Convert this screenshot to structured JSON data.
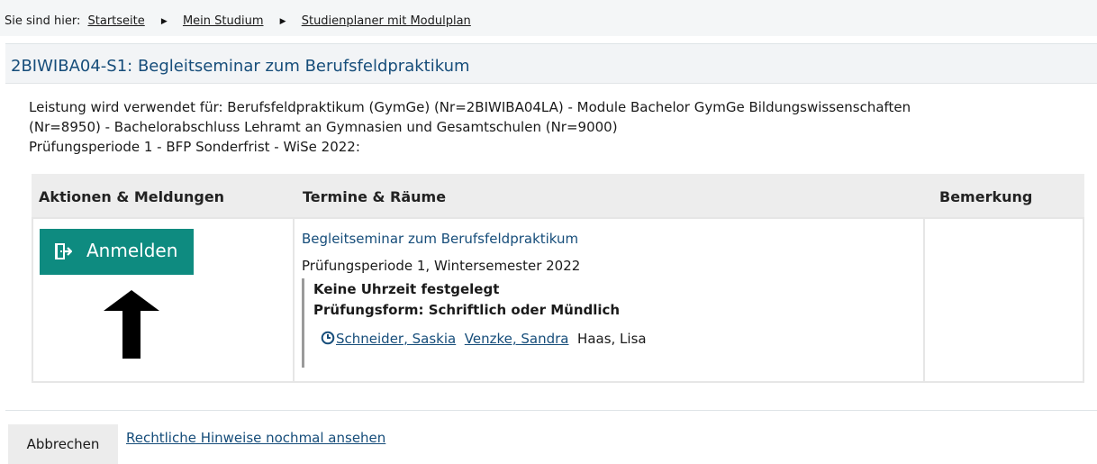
{
  "breadcrumb": {
    "prefix": "Sie sind hier:",
    "items": [
      {
        "label": "Startseite"
      },
      {
        "label": "Mein Studium"
      },
      {
        "label": "Studienplaner mit Modulplan"
      }
    ],
    "separator_icon": "triangle-right-icon"
  },
  "module": {
    "title": "2BIWIBA04-S1: Begleitseminar zum Berufsfeldpraktikum",
    "info_lines": [
      "Leistung wird verwendet für: Berufsfeldpraktikum (GymGe) (Nr=2BIWIBA04LA) - Module Bachelor GymGe Bildungswissenschaften",
      "(Nr=8950) - Bachelorabschluss Lehramt an Gymnasien und Gesamtschulen (Nr=9000)",
      "Prüfungsperiode 1 - BFP Sonderfrist - WiSe 2022:"
    ]
  },
  "table": {
    "headers": [
      "Aktionen & Meldungen",
      "Termine & Räume",
      "Bemerkung"
    ],
    "row": {
      "action_button": {
        "label": "Anmelden",
        "icon": "door-enter-icon"
      },
      "annotation_icon": "arrow-up-icon",
      "event_title": "Begleitseminar zum Berufsfeldpraktikum",
      "period": "Prüfungsperiode 1, Wintersemester 2022",
      "time": "Keine Uhrzeit festgelegt",
      "exam_form": "Prüfungsform: Schriftlich oder Mündlich",
      "people": [
        {
          "name": "Schneider, Saskia",
          "link": true
        },
        {
          "name": "Venzke, Sandra",
          "link": true
        },
        {
          "name": "Haas, Lisa",
          "link": false
        }
      ],
      "people_icon": "clock-icon",
      "remark": ""
    }
  },
  "footer": {
    "cancel_label": "Abbrechen",
    "legal_link": "Rechtliche Hinweise nochmal ansehen"
  },
  "colors": {
    "accent": "#0e8b80",
    "link": "#164d7a",
    "header_bg": "#ededed"
  }
}
